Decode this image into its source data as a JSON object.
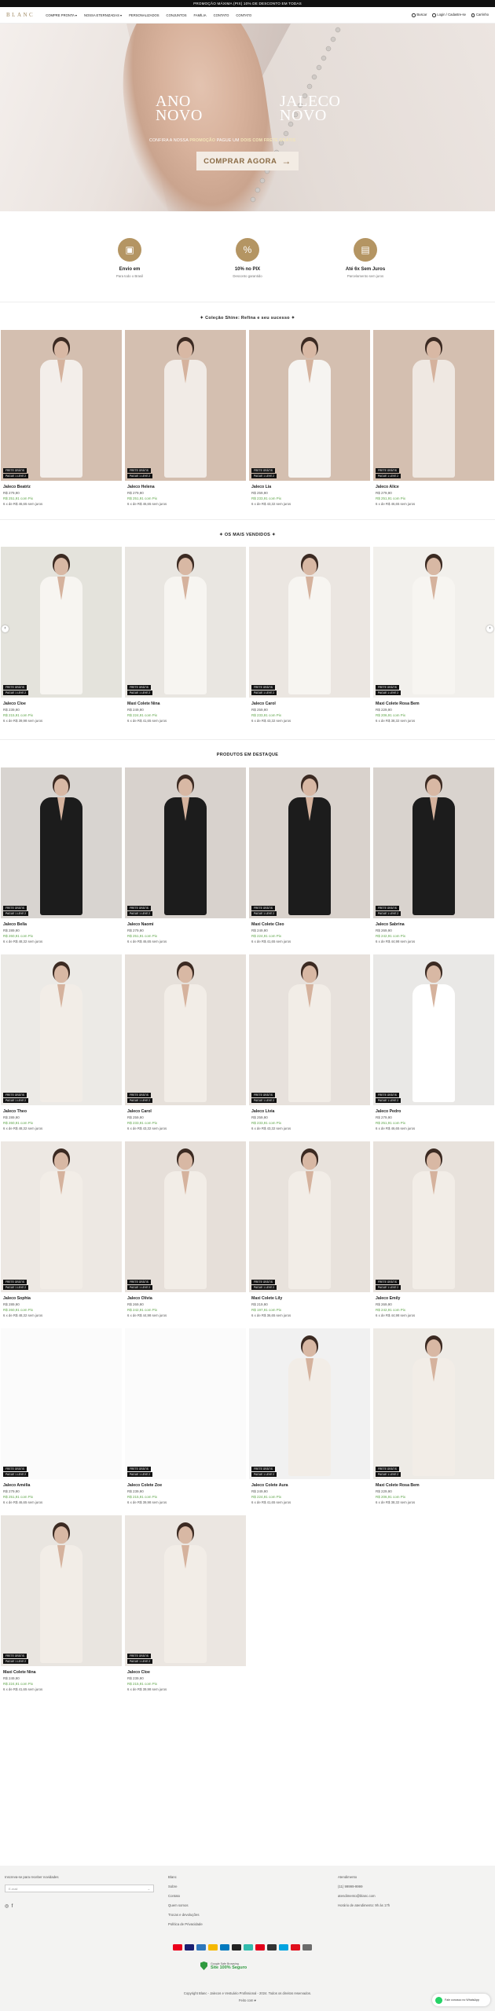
{
  "topbar": {
    "text": "PROMOÇÃO MÁXIMA (PIX) 10% DE DESCONTO EM TODAS"
  },
  "header": {
    "logo": "BLANC",
    "nav": [
      "COMPRE PRONTA ▾",
      "NOSSA ETERNIZADAS ▾",
      "PERSONALIZADOS",
      "CONJUNTOS",
      "FAMÍLIA",
      "CONTATO",
      "CONTATO"
    ],
    "search": "Buscar",
    "account": "Login / Cadastre-se",
    "cart": "Carrinho"
  },
  "hero": {
    "title1": "ANO NOVO",
    "title2": "JALECO NOVO",
    "sub_a": "CONFIRA A NOSSA",
    "sub_b": "PROMOÇÃO",
    "sub_c": "PAGUE UM",
    "sub_d": "DOIS COM",
    "sub_e": "FRETE GRÁTIS",
    "button": "COMPRAR AGORA"
  },
  "benefits": [
    {
      "icon": "truck-icon",
      "title": "Envio em",
      "sub": "Para todo o Brasil"
    },
    {
      "icon": "percent-icon",
      "title": "10% no PIX",
      "sub": "Desconto garantido"
    },
    {
      "icon": "card-icon",
      "title": "Até 6x Sem Juros",
      "sub": "Parcelamento sem juros"
    }
  ],
  "sections": {
    "s1": "✦ Coleção Shine: Refina e seu sucesso ✦",
    "s2": "✦ OS MAIS VENDIDOS ✦",
    "s3": "PRODUTOS EM DESTAQUE"
  },
  "badges": [
    "FRETE GRÁTIS",
    "PAGUE 1 LEVE 2"
  ],
  "products_shine": [
    {
      "name": "Jaleco Beatriz",
      "price": "R$ 279,90",
      "pix": "R$ 251,91 com Pix",
      "inst": "6 x de R$ 46,65 sem juros"
    },
    {
      "name": "Jaleco Helena",
      "price": "R$ 279,90",
      "pix": "R$ 251,91 com Pix",
      "inst": "6 x de R$ 46,65 sem juros"
    },
    {
      "name": "Jaleco Lia",
      "price": "R$ 259,90",
      "pix": "R$ 233,91 com Pix",
      "inst": "6 x de R$ 43,32 sem juros"
    },
    {
      "name": "Jaleco Alice",
      "price": "R$ 279,90",
      "pix": "R$ 251,91 com Pix",
      "inst": "6 x de R$ 46,65 sem juros"
    }
  ],
  "products_best": [
    {
      "name": "Jaleco Cloe",
      "price": "R$ 239,90",
      "pix": "R$ 215,91 com Pix",
      "inst": "6 x de R$ 39,98 sem juros"
    },
    {
      "name": "Maxi Colete Nina",
      "price": "R$ 249,90",
      "pix": "R$ 224,91 com Pix",
      "inst": "6 x de R$ 41,65 sem juros"
    },
    {
      "name": "Jaleco Carol",
      "price": "R$ 259,90",
      "pix": "R$ 233,91 com Pix",
      "inst": "6 x de R$ 43,32 sem juros"
    },
    {
      "name": "Maxi Colete Rosa Bem",
      "price": "R$ 229,90",
      "pix": "R$ 206,91 com Pix",
      "inst": "6 x de R$ 38,32 sem juros"
    }
  ],
  "products_featured": [
    {
      "name": "Jaleco Bella",
      "price": "R$ 289,90",
      "pix": "R$ 260,91 com Pix",
      "inst": "6 x de R$ 48,32 sem juros"
    },
    {
      "name": "Jaleco Naomi",
      "price": "R$ 279,90",
      "pix": "R$ 251,91 com Pix",
      "inst": "6 x de R$ 46,65 sem juros"
    },
    {
      "name": "Maxi Colete Cleo",
      "price": "R$ 249,90",
      "pix": "R$ 224,91 com Pix",
      "inst": "6 x de R$ 41,65 sem juros"
    },
    {
      "name": "Jaleco Sabrina",
      "price": "R$ 269,90",
      "pix": "R$ 242,91 com Pix",
      "inst": "6 x de R$ 44,98 sem juros"
    },
    {
      "name": "Jaleco Theo",
      "price": "R$ 289,90",
      "pix": "R$ 260,91 com Pix",
      "inst": "6 x de R$ 48,32 sem juros"
    },
    {
      "name": "Jaleco Carol",
      "price": "R$ 259,90",
      "pix": "R$ 233,91 com Pix",
      "inst": "6 x de R$ 43,32 sem juros"
    },
    {
      "name": "Jaleco Livia",
      "price": "R$ 259,90",
      "pix": "R$ 233,91 com Pix",
      "inst": "6 x de R$ 43,32 sem juros"
    },
    {
      "name": "Jaleco Pedro",
      "price": "R$ 279,90",
      "pix": "R$ 251,91 com Pix",
      "inst": "6 x de R$ 46,65 sem juros"
    },
    {
      "name": "Jaleco Sophia",
      "price": "R$ 289,90",
      "pix": "R$ 260,91 com Pix",
      "inst": "6 x de R$ 48,32 sem juros"
    },
    {
      "name": "Jaleco Olívia",
      "price": "R$ 269,90",
      "pix": "R$ 242,91 com Pix",
      "inst": "6 x de R$ 44,98 sem juros"
    },
    {
      "name": "Maxi Colete Lily",
      "price": "R$ 219,90",
      "pix": "R$ 197,91 com Pix",
      "inst": "6 x de R$ 36,65 sem juros"
    },
    {
      "name": "Jaleco Emily",
      "price": "R$ 269,90",
      "pix": "R$ 242,91 com Pix",
      "inst": "6 x de R$ 44,98 sem juros"
    },
    {
      "name": "Jaleco Amélia",
      "price": "R$ 279,90",
      "pix": "R$ 251,91 com Pix",
      "inst": "6 x de R$ 46,65 sem juros"
    },
    {
      "name": "Jaleco Colete Zoe",
      "price": "R$ 239,90",
      "pix": "R$ 215,91 com Pix",
      "inst": "6 x de R$ 39,98 sem juros"
    },
    {
      "name": "Jaleco Colete Aura",
      "price": "R$ 249,90",
      "pix": "R$ 224,91 com Pix",
      "inst": "6 x de R$ 41,65 sem juros"
    },
    {
      "name": "Maxi Colete Rosa Bem",
      "price": "R$ 229,90",
      "pix": "R$ 206,91 com Pix",
      "inst": "6 x de R$ 38,32 sem juros"
    },
    {
      "name": "Maxi Colete Nina",
      "price": "R$ 249,90",
      "pix": "R$ 224,91 com Pix",
      "inst": "6 x de R$ 41,65 sem juros"
    },
    {
      "name": "Jaleco Cloe",
      "price": "R$ 239,90",
      "pix": "R$ 215,91 com Pix",
      "inst": "6 x de R$ 39,98 sem juros"
    }
  ],
  "footer": {
    "newsletter_title": "Inscreva-se para receber novidades",
    "newsletter_placeholder": "E-mail",
    "newsletter_button": "→",
    "links": [
      "Blanc",
      "Sobre",
      "Contato",
      "Quem somos",
      "Trocas e devoluções",
      "Política de Privacidade"
    ],
    "contact_title": "Atendimento",
    "contact": [
      "(11) 99999-9999",
      "atendimento@blanc.com",
      "Horário de atendimento: 9h às 17h"
    ],
    "safe_a": "Google Safe Browsing",
    "safe_b": "Site 100% Seguro",
    "copyright": "Copyright Blanc - Jalecos e Vestuário Profissional - 2024. Todos os direitos reservados.",
    "powered": "Feito com ♥",
    "whatsapp": "Fale conosco no WhatsApp"
  }
}
